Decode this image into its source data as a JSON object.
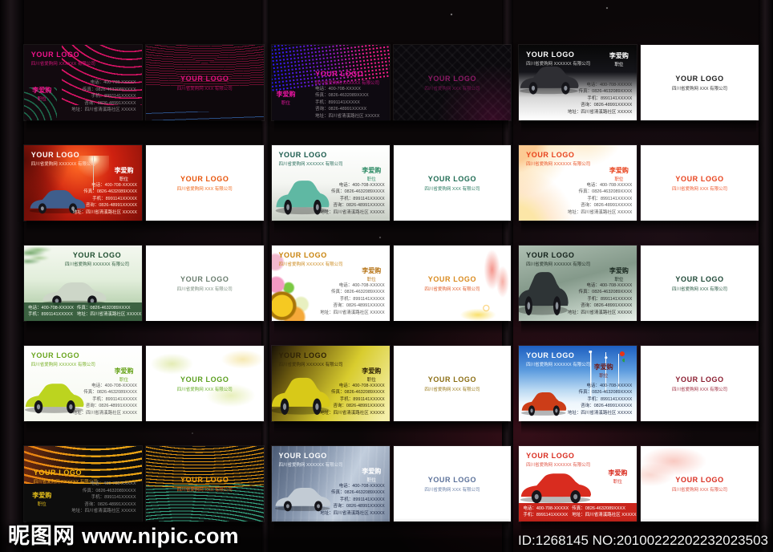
{
  "page": {
    "watermark_site": "昵图网",
    "watermark_url": "www.nipic.com",
    "watermark_id": "ID:1268145 NO:20100222202232023503"
  },
  "card_common": {
    "logo": "YOUR LOGO",
    "company_front": "四川省爱购网 XXXXXX 有限公司",
    "company_back": "四川省爱购网 XXX 有限公司",
    "person_name": "李爱购",
    "person_title": "职位",
    "contact": [
      {
        "label": "电话：",
        "value": "400-708-XXXXX"
      },
      {
        "label": "传真：",
        "value": "0826-4632089XXXX"
      },
      {
        "label": "手机：",
        "value": "8991141XXXXX"
      },
      {
        "label": "咨询：",
        "value": "0826-48991XXXXX"
      },
      {
        "label": "地址：",
        "value": "四川省清溪路社区 XXXXX"
      }
    ]
  },
  "cells": [
    {
      "name": "neon-pink-curves",
      "theme": "t01",
      "layout": "side"
    },
    {
      "name": "dot-wave-purple",
      "theme": "t02",
      "layout": "side"
    },
    {
      "name": "black-sports-car",
      "theme": "t03",
      "layout": "right"
    },
    {
      "name": "red-night-car",
      "theme": "t04",
      "layout": "right"
    },
    {
      "name": "teal-cartoon-car",
      "theme": "t05",
      "layout": "right"
    },
    {
      "name": "orange-corner-pattern",
      "theme": "t06",
      "layout": "right"
    },
    {
      "name": "green-bamboo-sedan",
      "theme": "t07",
      "layout": "strip"
    },
    {
      "name": "sunflower-floral",
      "theme": "t08",
      "layout": "right"
    },
    {
      "name": "gray-green-scooter",
      "theme": "t09",
      "layout": "right"
    },
    {
      "name": "lime-sports-car",
      "theme": "t10",
      "layout": "right"
    },
    {
      "name": "yellow-motorcycle",
      "theme": "t11",
      "layout": "right"
    },
    {
      "name": "truck-wind-farm",
      "theme": "t12",
      "layout": "right"
    },
    {
      "name": "rainbow-mesh-black",
      "theme": "t13",
      "layout": "side"
    },
    {
      "name": "steel-blue-sedan",
      "theme": "t14",
      "layout": "right"
    },
    {
      "name": "red-ferrari",
      "theme": "t15",
      "layout": "strip"
    }
  ],
  "colors": {
    "background": "#0b0708",
    "accent_magenta": "#f0148c",
    "accent_red": "#d92c1f",
    "accent_green": "#68a41c",
    "watermark_text": "#ffffff"
  }
}
